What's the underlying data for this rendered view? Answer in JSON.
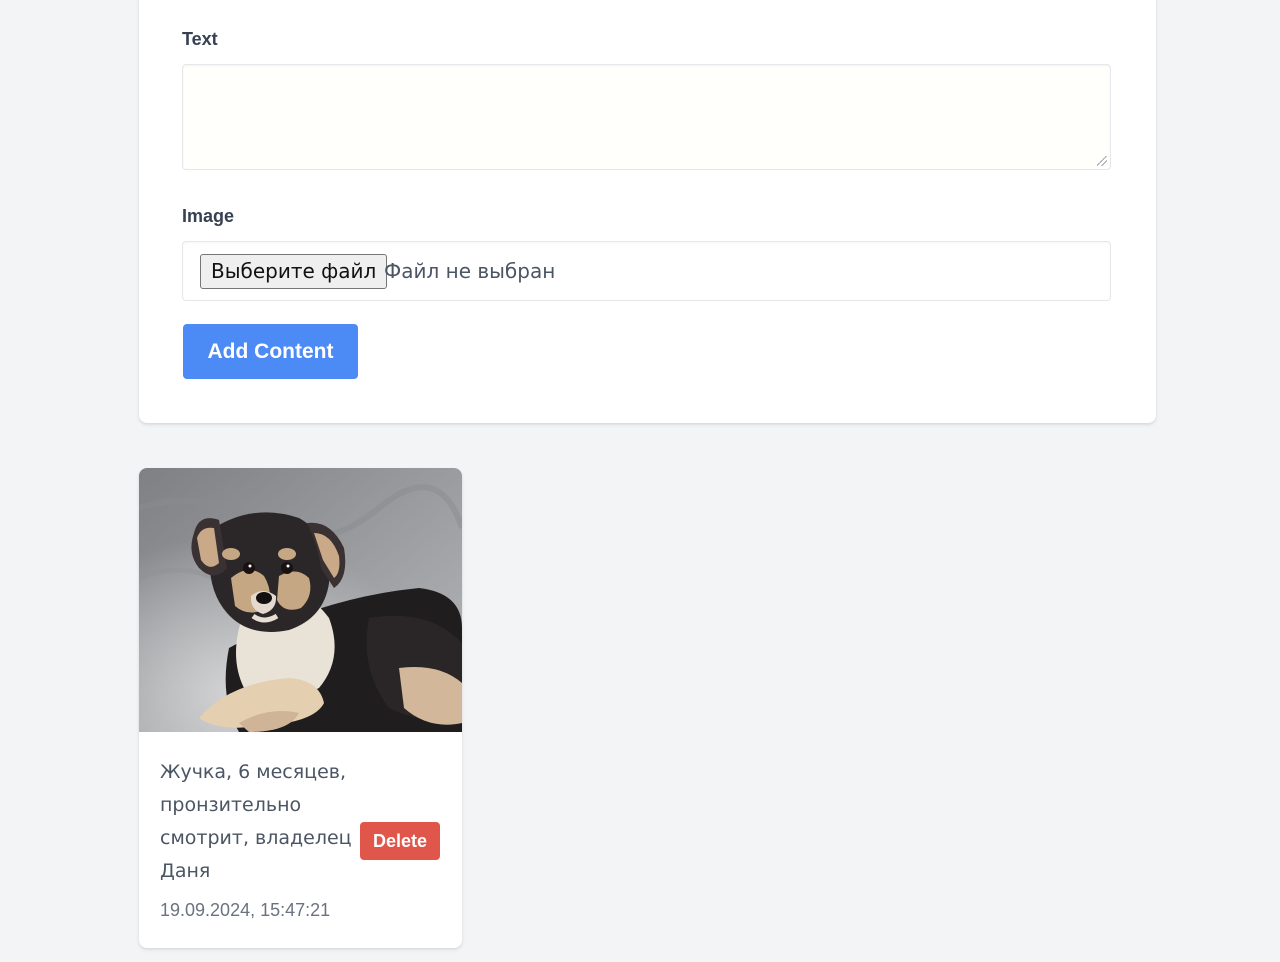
{
  "form": {
    "text_label": "Text",
    "text_value": "",
    "image_label": "Image",
    "file_button_label": "Выберите файл",
    "file_status": "Файл не выбран",
    "submit_label": "Add Content"
  },
  "posts": [
    {
      "image_icon": "puppy-photo",
      "text": "Жучка, 6 месяцев, пронзительно смотрит, владелец Даня",
      "delete_label": "Delete",
      "date": "19.09.2024, 15:47:21"
    }
  ],
  "colors": {
    "page_background": "#f3f4f6",
    "primary_button": "#4c8af5",
    "delete_button": "#e0564a",
    "card_background": "#ffffff"
  }
}
